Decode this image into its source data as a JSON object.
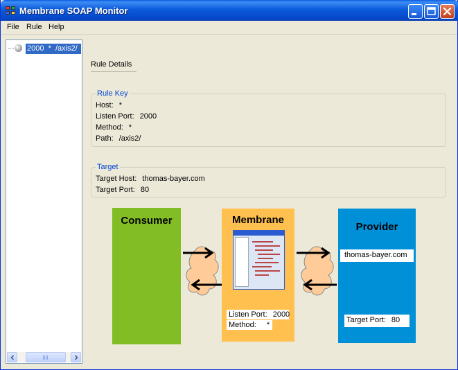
{
  "window": {
    "title": "Membrane SOAP Monitor",
    "colors": {
      "title_bar": "#0b5bdb",
      "close_button": "#c2401d",
      "selection": "#316ac5"
    }
  },
  "menu": {
    "file": "File",
    "rule": "Rule",
    "help": "Help"
  },
  "tree": {
    "items": [
      {
        "label": "2000  *  /axis2/",
        "selected": true
      }
    ]
  },
  "details": {
    "tab_label": "Rule Details",
    "rule_key": {
      "title": "Rule Key",
      "host_label": "Host:",
      "host_value": "*",
      "port_label": "Listen Port:",
      "port_value": "2000",
      "method_label": "Method:",
      "method_value": "*",
      "path_label": "Path:",
      "path_value": "/axis2/"
    },
    "target": {
      "title": "Target",
      "host_label": "Target Host:",
      "host_value": "thomas-bayer.com",
      "port_label": "Target Port:",
      "port_value": "80"
    }
  },
  "diagram": {
    "consumer": {
      "title": "Consumer",
      "color": "#82bd25"
    },
    "membrane": {
      "title": "Membrane",
      "color": "#ffc050",
      "port_label": "Listen Port:",
      "port_value": "2000",
      "method_label": "Method:",
      "method_value": "*"
    },
    "provider": {
      "title": "Provider",
      "color": "#0090d8",
      "host_value": "thomas-bayer.com",
      "port_label": "Target Port:",
      "port_value": "80"
    },
    "cloud_color": "#ffcc99"
  }
}
